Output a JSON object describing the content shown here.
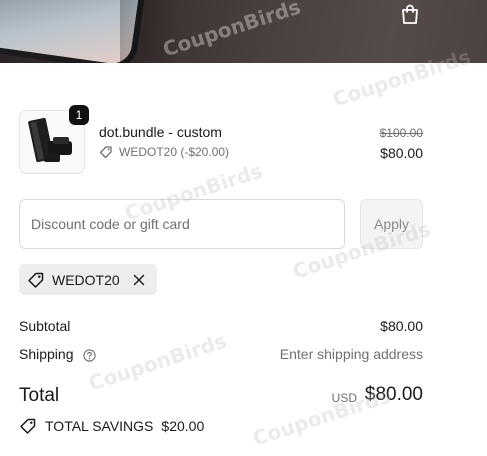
{
  "header": {
    "cart_icon": "shopping-bag-icon"
  },
  "line_item": {
    "quantity": "1",
    "name": "dot.bundle - custom",
    "discount": "WEDOT20 (-$20.00)",
    "original_price": "$100.00",
    "price": "$80.00"
  },
  "discount_form": {
    "placeholder": "Discount code or gift card",
    "apply_label": "Apply"
  },
  "applied_code": {
    "code": "WEDOT20"
  },
  "summary": {
    "subtotal_label": "Subtotal",
    "subtotal_value": "$80.00",
    "shipping_label": "Shipping",
    "shipping_value": "Enter shipping address",
    "total_label": "Total",
    "currency": "USD",
    "total_value": "$80.00",
    "savings_label": "TOTAL SAVINGS",
    "savings_value": "$20.00"
  },
  "watermark": "CouponBirds"
}
